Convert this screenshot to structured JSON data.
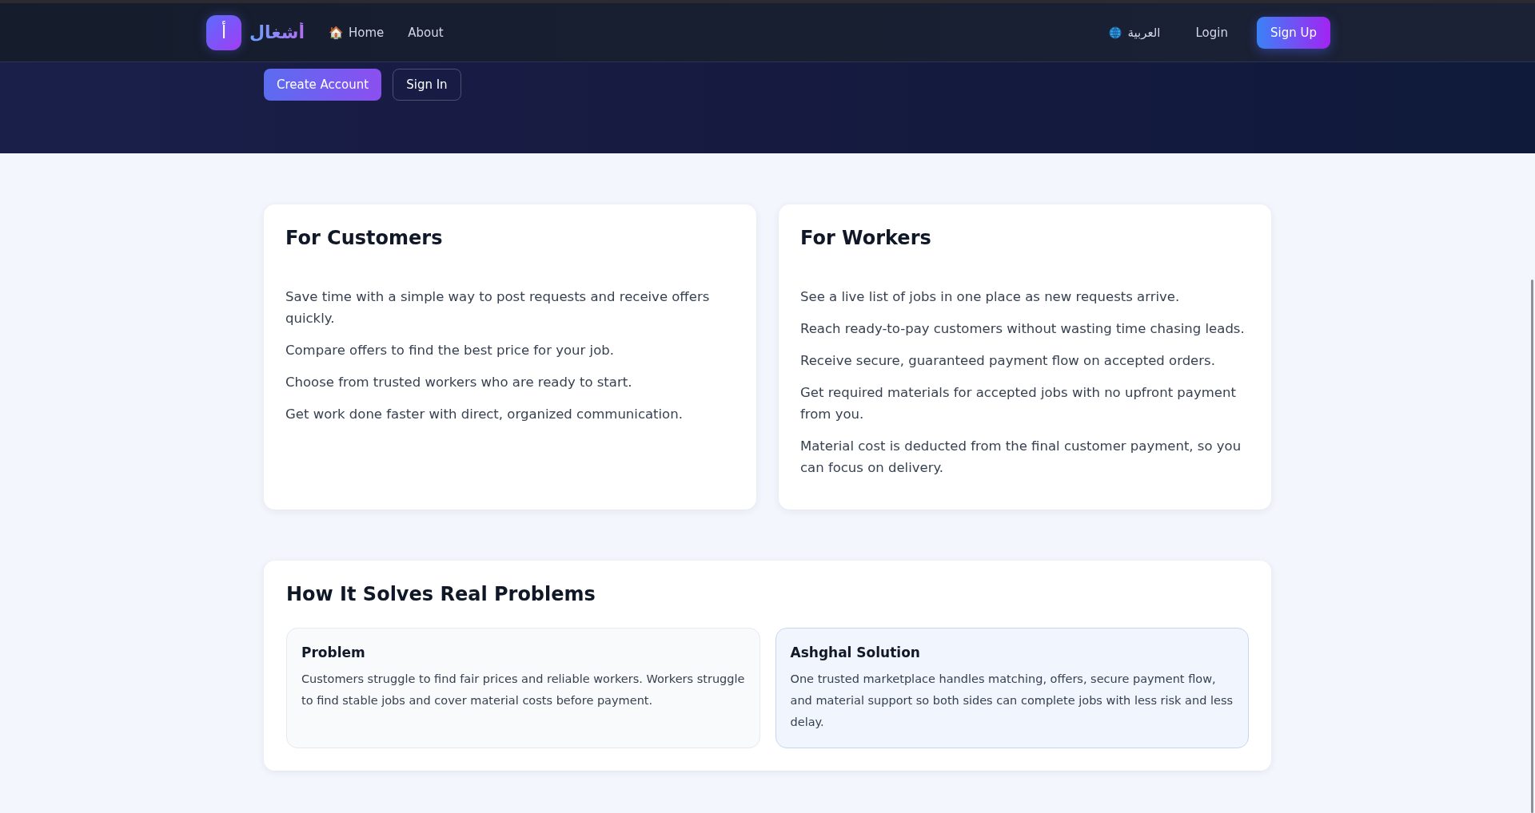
{
  "header": {
    "logo_letter": "أ",
    "brand": "أشغال",
    "nav": [
      {
        "label": "Home",
        "icon": "🏠"
      },
      {
        "label": "About"
      }
    ],
    "language": "العربية",
    "login": "Login",
    "signup": "Sign Up"
  },
  "hero": {
    "buttons": [
      {
        "label": "Create Account",
        "kind": "primary"
      },
      {
        "label": "Sign In",
        "kind": "outline"
      }
    ]
  },
  "audiences": [
    {
      "title": "For Customers",
      "points": [
        "Save time with a simple way to post requests and receive offers quickly.",
        "Compare offers to find the best price for your job.",
        "Choose from trusted workers who are ready to start.",
        "Get work done faster with direct, organized communication."
      ]
    },
    {
      "title": "For Workers",
      "points": [
        "See a live list of jobs in one place as new requests arrive.",
        "Reach ready-to-pay customers without wasting time chasing leads.",
        "Receive secure, guaranteed payment flow on accepted orders.",
        "Get required materials for accepted jobs with no upfront payment from you.",
        "Material cost is deducted from the final customer payment, so you can focus on delivery."
      ]
    }
  ],
  "problems": {
    "title": "How It Solves Real Problems",
    "items": [
      {
        "kind": "problem",
        "title": "Problem",
        "text": "Customers struggle to find fair prices and reliable workers. Workers struggle to find stable jobs and cover material costs before payment."
      },
      {
        "kind": "solution",
        "title": "Ashghal Solution",
        "text": "One trusted marketplace handles matching, offers, secure payment flow, and material support so both sides can complete jobs with less risk and less delay."
      }
    ]
  }
}
